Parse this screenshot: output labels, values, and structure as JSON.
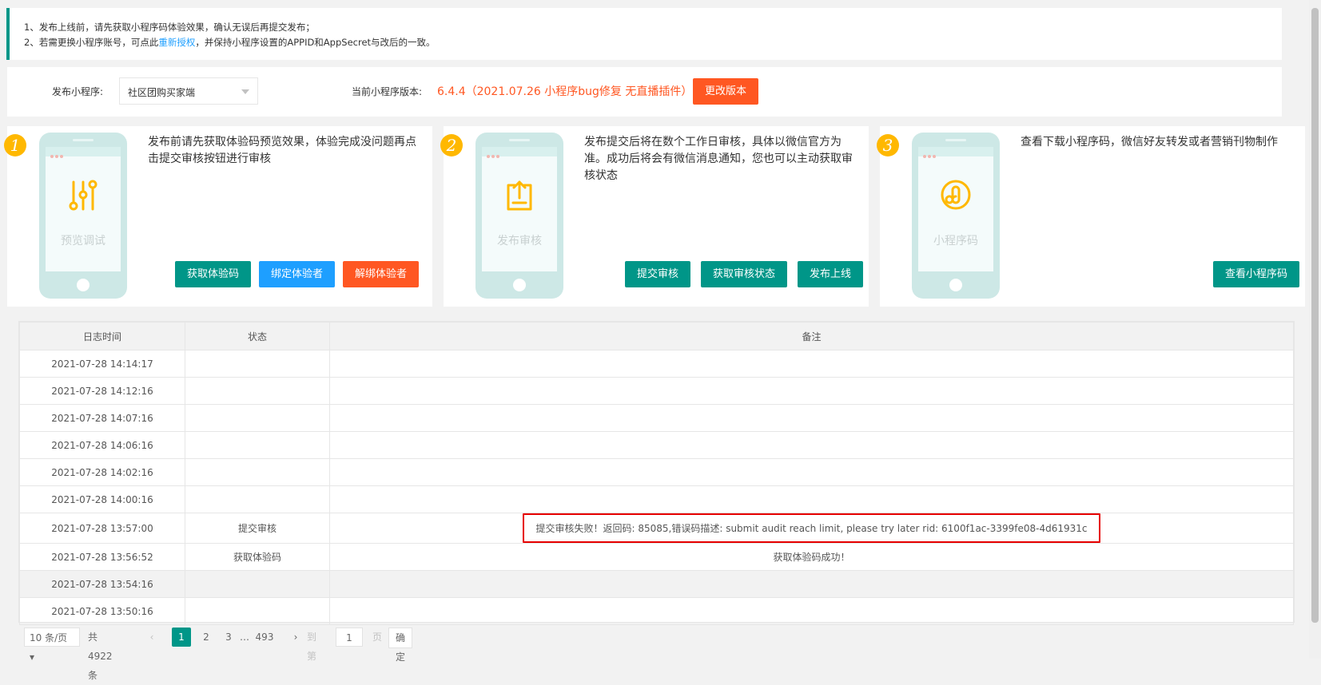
{
  "notice": {
    "line1": "1、发布上线前，请先获取小程序码体验效果，确认无误后再提交发布；",
    "line2_pre": "2、若需更换小程序账号，可点此",
    "line2_link": "重新授权",
    "line2_post": "，并保持小程序设置的APPID和AppSecret与改后的一致。"
  },
  "publish": {
    "label": "发布小程序:",
    "selected": "社区团购买家端",
    "version_label": "当前小程序版本:",
    "version_value": "6.4.4（2021.07.26 小程序bug修复 无直播插件）",
    "change_button": "更改版本"
  },
  "steps": [
    {
      "number": "1",
      "icon": "sliders-icon",
      "caption": "预览调试",
      "description": "发布前请先获取体验码预览效果，体验完成没问题再点击提交审核按钮进行审核",
      "buttons": [
        "获取体验码",
        "绑定体验者",
        "解绑体验者"
      ]
    },
    {
      "number": "2",
      "icon": "upload-doc-icon",
      "caption": "发布审核",
      "description": "发布提交后将在数个工作日审核，具体以微信官方为准。成功后将会有微信消息通知，您也可以主动获取审核状态",
      "buttons": [
        "提交审核",
        "获取审核状态",
        "发布上线"
      ]
    },
    {
      "number": "3",
      "icon": "mini-program-icon",
      "caption": "小程序码",
      "description": "查看下载小程序码，微信好友转发或者营销刊物制作",
      "buttons": [
        "查看小程序码"
      ]
    }
  ],
  "log_table": {
    "headers": [
      "日志时间",
      "状态",
      "备注"
    ],
    "rows": [
      {
        "time": "2021-07-28 14:14:17",
        "status": "",
        "remark": ""
      },
      {
        "time": "2021-07-28 14:12:16",
        "status": "",
        "remark": ""
      },
      {
        "time": "2021-07-28 14:07:16",
        "status": "",
        "remark": ""
      },
      {
        "time": "2021-07-28 14:06:16",
        "status": "",
        "remark": ""
      },
      {
        "time": "2021-07-28 14:02:16",
        "status": "",
        "remark": ""
      },
      {
        "time": "2021-07-28 14:00:16",
        "status": "",
        "remark": ""
      },
      {
        "time": "2021-07-28 13:57:00",
        "status": "提交审核",
        "remark": "提交审核失败！返回码: 85085,错误码描述: submit audit reach limit, please try later rid: 6100f1ac-3399fe08-4d61931c"
      },
      {
        "time": "2021-07-28 13:56:52",
        "status": "获取体验码",
        "remark": "获取体验码成功！"
      },
      {
        "time": "2021-07-28 13:54:16",
        "status": "",
        "remark": ""
      },
      {
        "time": "2021-07-28 13:50:16",
        "status": "",
        "remark": ""
      }
    ]
  },
  "pagination": {
    "page_size": "10 条/页",
    "total": "共 4922 条",
    "prev": "‹",
    "pages": [
      "1",
      "2",
      "3"
    ],
    "ellipsis": "…",
    "last": "493",
    "next": "›",
    "goto_label": "到第",
    "goto_value": "1",
    "page_unit": "页",
    "confirm": "确定"
  },
  "colors": {
    "primary": "#009688",
    "blue": "#1e9fff",
    "orange": "#ff5722",
    "step_badge": "#ffb800",
    "error_border": "#e60000"
  }
}
